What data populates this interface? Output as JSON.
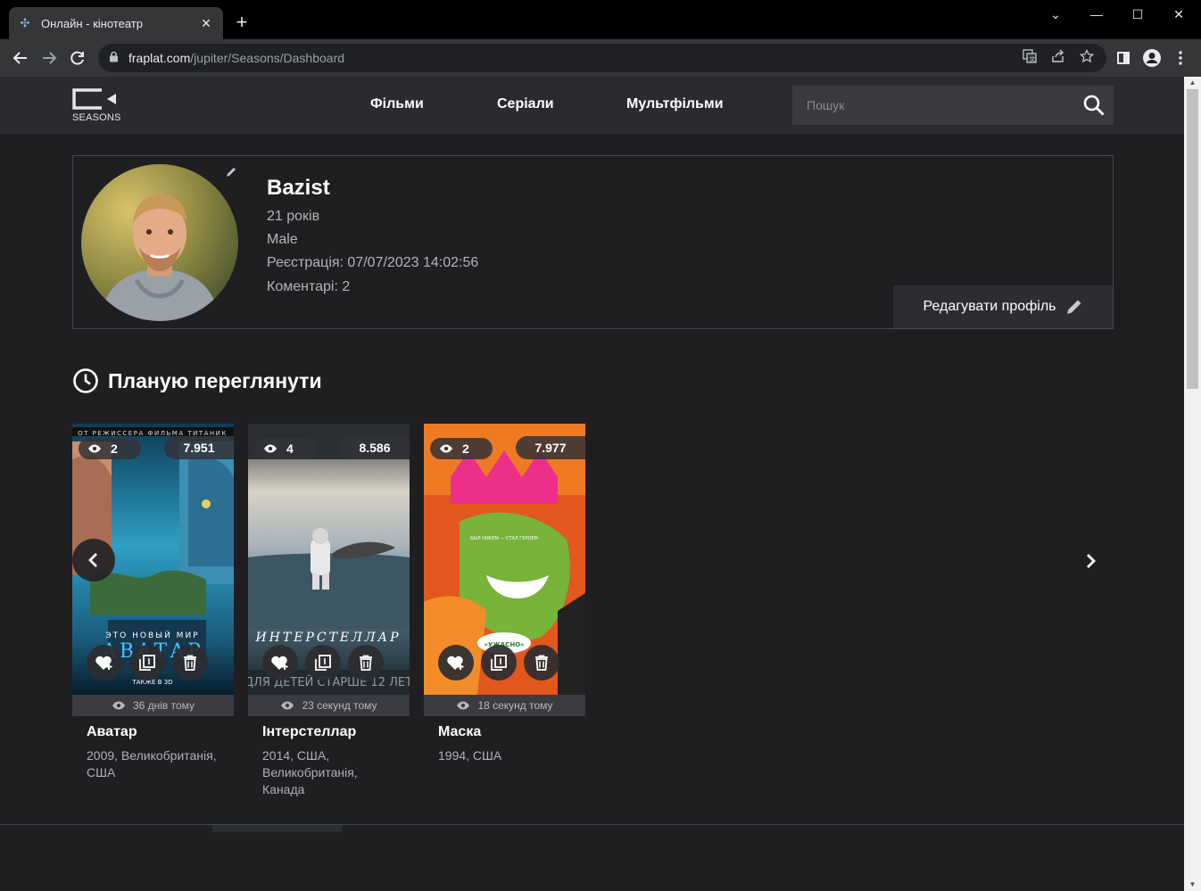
{
  "browser": {
    "tab_title": "Онлайн - кінотеатр",
    "url_host": "fraplat.com",
    "url_path": "/jupiter/Seasons/Dashboard"
  },
  "site": {
    "logo_text": "SEASONS",
    "nav": [
      "Фільми",
      "Серіали",
      "Мультфільми"
    ],
    "search_placeholder": "Пошук"
  },
  "profile": {
    "name": "Bazist",
    "age": "21 років",
    "gender": "Male",
    "registration": "Реєстрація: 07/07/2023 14:02:56",
    "comments": "Коментарі: 2",
    "edit_label": "Редагувати профіль"
  },
  "watchlist": {
    "title": "Планую переглянути",
    "movies": [
      {
        "views": "2",
        "rating": "7.951",
        "watched": "36 днів тому",
        "title": "Аватар",
        "meta": "2009, Великобританія, США"
      },
      {
        "views": "4",
        "rating": "8.586",
        "watched": "23 секунд тому",
        "title": "Інтерстеллар",
        "meta": "2014, США, Великобританія, Канада"
      },
      {
        "views": "2",
        "rating": "7.977",
        "watched": "18 секунд тому",
        "title": "Маска",
        "meta": "1994, США"
      }
    ]
  },
  "colors": {
    "page_bg": "#1f1f21",
    "header_bg": "#2a2b2e",
    "card_border": "#47484c"
  }
}
